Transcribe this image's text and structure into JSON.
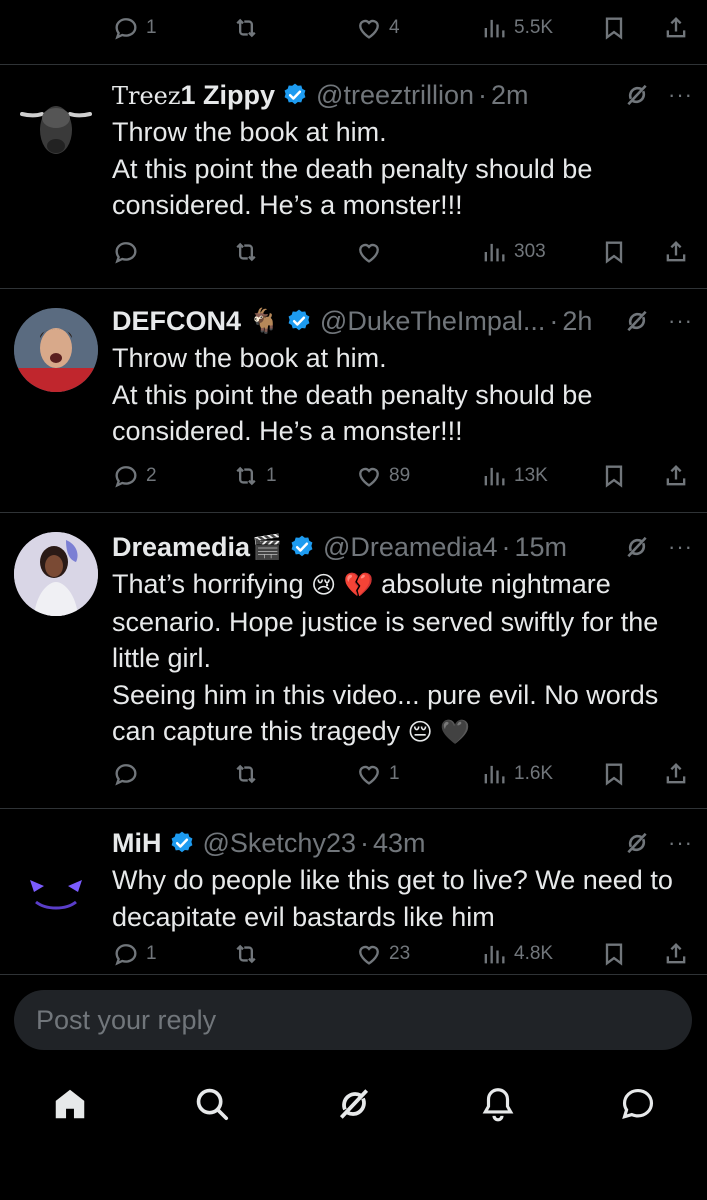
{
  "top_actions": {
    "replies": "1",
    "reposts": "",
    "likes": "4",
    "views": "5.5K"
  },
  "tweets": [
    {
      "display_name_prefix": "Treez",
      "display_name": "1 Zippy",
      "handle": "@treeztrillion",
      "time": "2m",
      "lines": [
        "Throw the book at him.",
        "At this point the death penalty should be considered. He’s a monster!!!"
      ],
      "replies": "",
      "reposts": "",
      "likes": "",
      "views": "303"
    },
    {
      "display_name": "DEFCON4",
      "name_emoji": "🐐",
      "handle": "@DukeTheImpal...",
      "time": "2h",
      "lines": [
        "Throw the book at him.",
        "At this point the death penalty should be considered. He’s a monster!!!"
      ],
      "replies": "2",
      "reposts": "1",
      "likes": "89",
      "views": "13K"
    },
    {
      "display_name": "Dreamedia",
      "name_emoji": "🎬",
      "handle": "@Dreamedia4",
      "time": "15m",
      "line1_a": "That’s horrifying ",
      "line1_emoji": "😢 💔",
      "line1_b": " absolute nightmare scenario. Hope justice is served swiftly for the little girl.",
      "line2_a": "Seeing him in this video... pure evil. No words can capture this tragedy ",
      "line2_emoji": "😔 🖤",
      "replies": "",
      "reposts": "",
      "likes": "1",
      "views": "1.6K"
    },
    {
      "display_name": "MiH",
      "handle": "@Sketchy23",
      "time": "43m",
      "lines": [
        "Why do people like this get to live? We need to decapitate evil bastards like him"
      ],
      "replies": "1",
      "reposts": "",
      "likes": "23",
      "views": "4.8K"
    }
  ],
  "reply_box": {
    "placeholder": "Post your reply"
  },
  "nav": [
    "home-icon",
    "search-icon",
    "grok-icon",
    "notifications-icon",
    "messages-icon"
  ],
  "colors": {
    "background": "#000000",
    "text": "#e7e9ea",
    "muted": "#71767b",
    "verified": "#1d9bf0",
    "divider": "#2f3336",
    "input_bg": "#202327"
  }
}
